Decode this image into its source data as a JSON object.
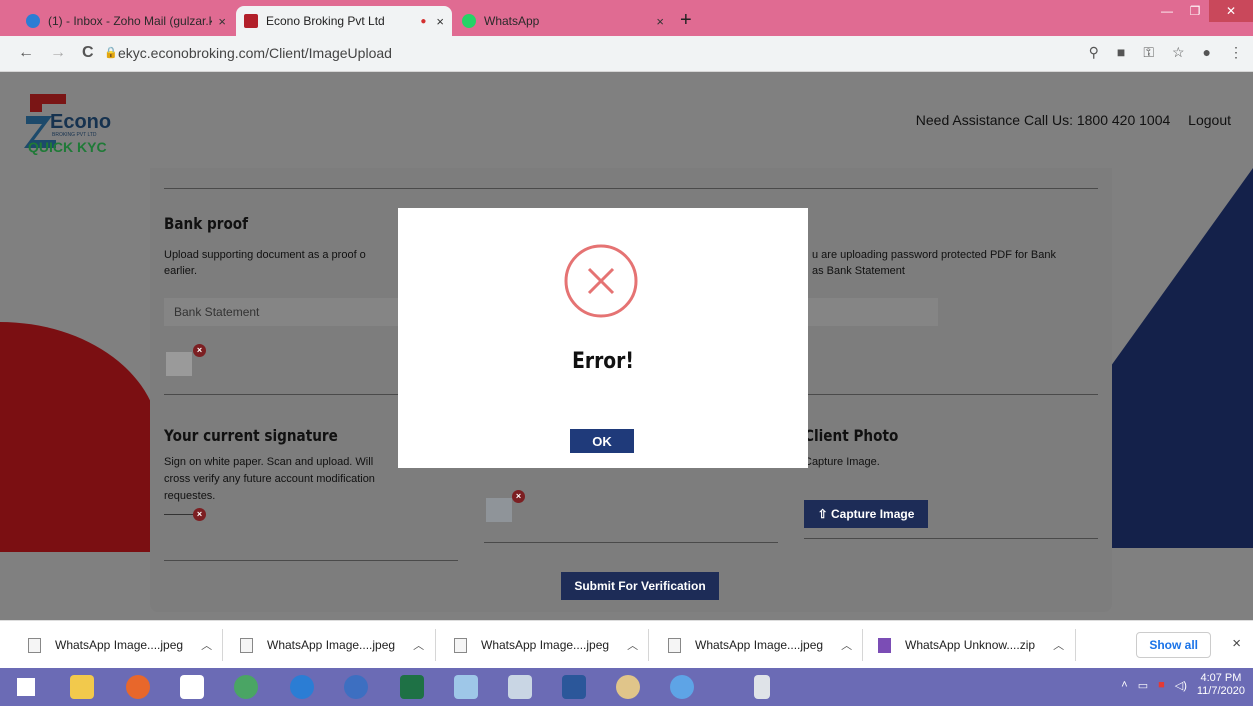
{
  "browser": {
    "tabs": [
      {
        "title": "(1) - Inbox - Zoho Mail (gulzar.ka",
        "active": false
      },
      {
        "title": "Econo Broking Pvt Ltd",
        "active": true
      },
      {
        "title": "WhatsApp",
        "active": false
      }
    ],
    "close_glyph": "×",
    "new_tab_glyph": "+",
    "url_host": "ekyc.econobroking.com",
    "url_path": "/Client/ImageUpload",
    "nav": {
      "back": "←",
      "forward": "→",
      "reload": "C"
    }
  },
  "site": {
    "logo_text": "Econo",
    "logo_subtext": "BROKING PVT LTD",
    "quick_kyc": "QUICK KYC",
    "assistance": "Need Assistance Call Us: 1800 420 1004",
    "logout": "Logout"
  },
  "form": {
    "bank_title": "Bank proof",
    "bank_desc_left": "Upload supporting document as a proof o",
    "bank_desc_left2": "earlier.",
    "bank_desc_right": "u are uploading password protected PDF for Bank",
    "bank_desc_right2": "as Bank Statement",
    "bank_select": "Bank Statement",
    "sig_title": "Your current signature",
    "sig_desc1": "Sign on white paper. Scan and upload. Will",
    "sig_desc2": "cross  verify  any  future  account  modification",
    "sig_desc3": "requestes.",
    "photo_title": "Client Photo",
    "photo_desc": "Capture Image.",
    "capture_label": "Capture Image",
    "submit_label": "Submit For Verification",
    "remove_glyph": "×"
  },
  "modal": {
    "title": "Error!",
    "ok_label": "OK"
  },
  "downloads": {
    "items": [
      "WhatsApp Image....jpeg",
      "WhatsApp Image....jpeg",
      "WhatsApp Image....jpeg",
      "WhatsApp Image....jpeg",
      "WhatsApp Unknow....zip"
    ],
    "show_all": "Show all",
    "close_glyph": "×"
  },
  "taskbar": {
    "time": "4:07 PM",
    "date": "11/7/2020"
  },
  "colors": {
    "tabbar": "#e06b92",
    "brand_green": "#1f7a37",
    "button_dark": "#1d2c57",
    "error_red": "#e57373"
  }
}
